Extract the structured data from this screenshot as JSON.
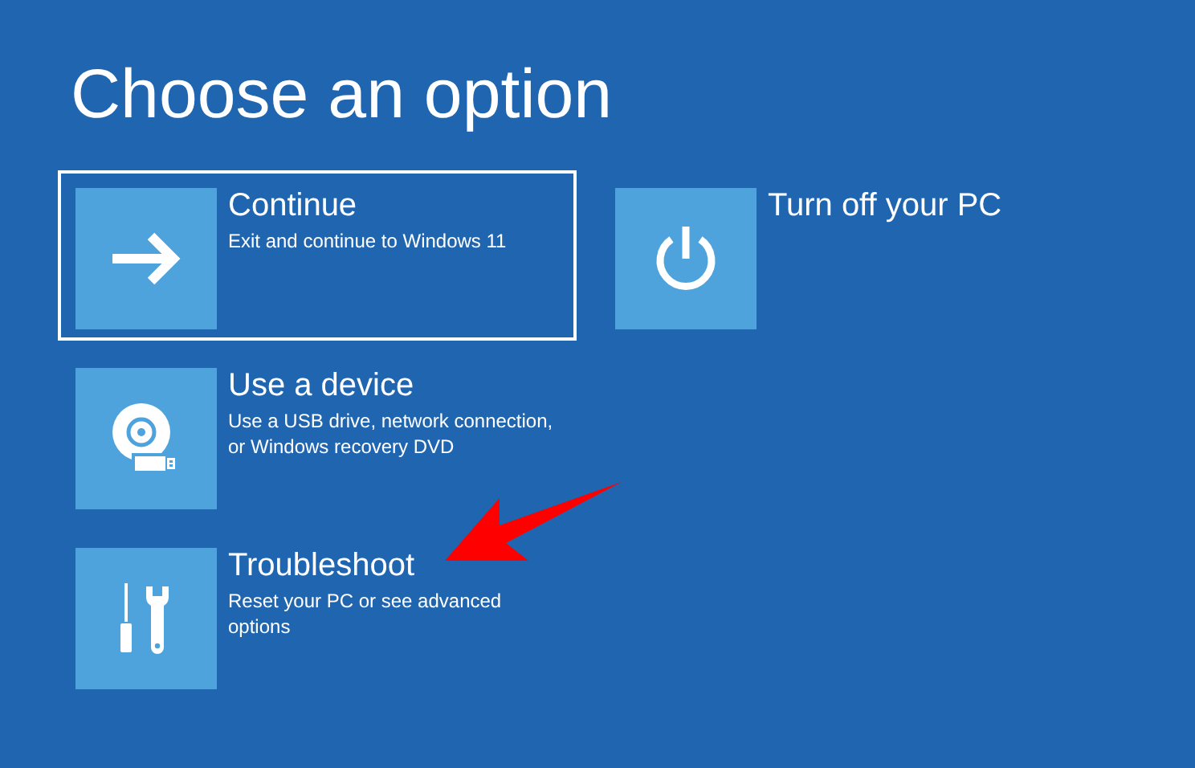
{
  "title": "Choose an option",
  "columns": [
    {
      "options": [
        {
          "kind": "arrow",
          "title": "Continue",
          "description": "Exit and continue to Windows 11",
          "selected": true
        },
        {
          "kind": "device",
          "title": "Use a device",
          "description": "Use a USB drive, network connection, or Windows recovery DVD",
          "selected": false
        },
        {
          "kind": "tools",
          "title": "Troubleshoot",
          "description": "Reset your PC or see advanced options",
          "selected": false
        }
      ]
    },
    {
      "options": [
        {
          "kind": "power",
          "title": "Turn off your PC",
          "selected": false
        }
      ]
    }
  ]
}
